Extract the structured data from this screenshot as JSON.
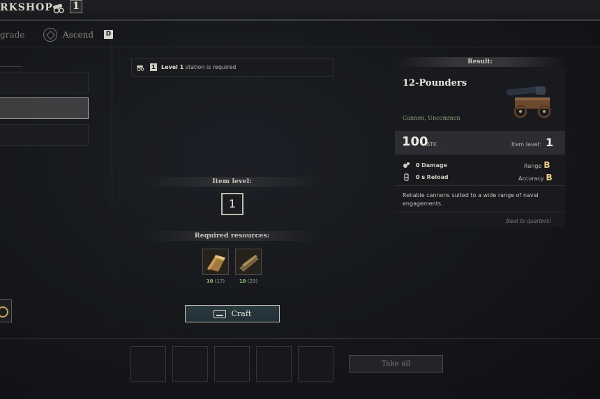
{
  "header": {
    "title": "RKSHOP",
    "station_level": "1"
  },
  "tabs": {
    "upgrade_label": "grade",
    "ascend_label": "Ascend",
    "ascend_key": "D"
  },
  "requirement": {
    "level": "1",
    "level_text": "Level 1",
    "suffix": "station is required"
  },
  "item_level": {
    "header": "Item level:",
    "value": "1"
  },
  "resources": {
    "header": "Required resources:",
    "items": [
      {
        "icon": "copper-ingot-icon",
        "have": "10",
        "required": "(17)"
      },
      {
        "icon": "timber-icon",
        "have": "10",
        "required": "(29)"
      }
    ]
  },
  "craft": {
    "label": "Craft"
  },
  "bottom": {
    "take_all_label": "Take all",
    "slot_count": 5
  },
  "result": {
    "header": "Result:",
    "name": "12-Pounders",
    "type": "Cannon, Uncommon",
    "attack": "100",
    "attack_unit": "ATK",
    "item_level_label": "Item level:",
    "item_level": "1",
    "damage_value": "0",
    "damage_label": "Damage",
    "reload_value": "0 s",
    "reload_label": "Reload",
    "range_label": "Range",
    "range_grade": "B",
    "accuracy_label": "Accuracy",
    "accuracy_grade": "B",
    "description": "Reliable cannons suited to a wide range of naval engagements.",
    "flavor": "Beat to quarters!"
  },
  "colors": {
    "accent_gold": "#f0d27a",
    "craft_button": "#2b3a3e",
    "resource_ok": "#8fbf6b"
  }
}
